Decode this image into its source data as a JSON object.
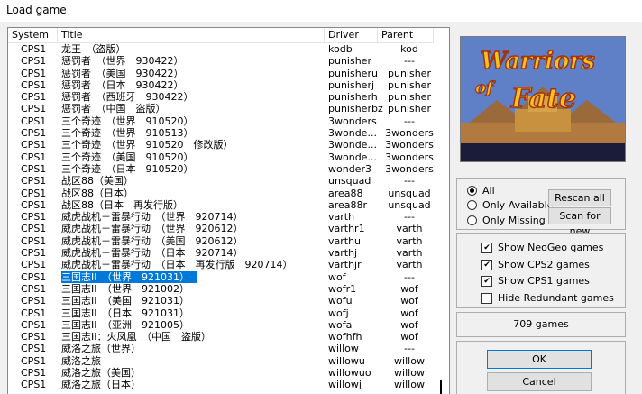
{
  "window": {
    "title": "Load game"
  },
  "columns": {
    "system": "System",
    "title": "Title",
    "driver": "Driver",
    "parent": "Parent"
  },
  "rows": [
    {
      "system": "CPS1",
      "title": "龙王　（盗版）",
      "driver": "kodb",
      "parent": "kod"
    },
    {
      "system": "CPS1",
      "title": "惩罚者　（世界　930422）",
      "driver": "punisher",
      "parent": "---"
    },
    {
      "system": "CPS1",
      "title": "惩罚者　（美国　930422）",
      "driver": "punisheru",
      "parent": "punisher"
    },
    {
      "system": "CPS1",
      "title": "惩罚者　（日本　930422）",
      "driver": "punisherj",
      "parent": "punisher"
    },
    {
      "system": "CPS1",
      "title": "惩罚者　（西班牙　930422）",
      "driver": "punisherh",
      "parent": "punisher"
    },
    {
      "system": "CPS1",
      "title": "惩罚者　（中国　盗版）",
      "driver": "punisherbz",
      "parent": "punisher"
    },
    {
      "system": "CPS1",
      "title": "三个奇迹　（世界　910520）",
      "driver": "3wonders",
      "parent": "---"
    },
    {
      "system": "CPS1",
      "title": "三个奇迹　（世界　910513）",
      "driver": "3wonde...",
      "parent": "3wonders"
    },
    {
      "system": "CPS1",
      "title": "三个奇迹　（世界　910520　修改版）",
      "driver": "3wonde...",
      "parent": "3wonders"
    },
    {
      "system": "CPS1",
      "title": "三个奇迹　（美国　910520）",
      "driver": "3wonde...",
      "parent": "3wonders"
    },
    {
      "system": "CPS1",
      "title": "三个奇迹　（日本　910520）",
      "driver": "wonder3",
      "parent": "3wonders"
    },
    {
      "system": "CPS1",
      "title": "战区88（美国）",
      "driver": "unsquad",
      "parent": "---"
    },
    {
      "system": "CPS1",
      "title": "战区88（日本）",
      "driver": "area88",
      "parent": "unsquad"
    },
    {
      "system": "CPS1",
      "title": "战区88（日本　再发行版）",
      "driver": "area88r",
      "parent": "unsquad"
    },
    {
      "system": "CPS1",
      "title": "威虎战机－雷暴行动　（世界　920714）",
      "driver": "varth",
      "parent": "---"
    },
    {
      "system": "CPS1",
      "title": "威虎战机－雷暴行动　（世界　920612）",
      "driver": "varthr1",
      "parent": "varth"
    },
    {
      "system": "CPS1",
      "title": "威虎战机－雷暴行动　（美国　920612）",
      "driver": "varthu",
      "parent": "varth"
    },
    {
      "system": "CPS1",
      "title": "威虎战机－雷暴行动　（日本　920714）",
      "driver": "varthj",
      "parent": "varth"
    },
    {
      "system": "CPS1",
      "title": "威虎战机－雷暴行动　（日本　再发行版　920714）",
      "driver": "varthjr",
      "parent": "varth"
    },
    {
      "system": "CPS1",
      "title": "三国志II　（世界　921031）",
      "driver": "wof",
      "parent": "---"
    },
    {
      "system": "CPS1",
      "title": "三国志II　（世界　921002）",
      "driver": "wofr1",
      "parent": "wof"
    },
    {
      "system": "CPS1",
      "title": "三国志II　（美国　921031）",
      "driver": "wofu",
      "parent": "wof"
    },
    {
      "system": "CPS1",
      "title": "三国志II　（日本　921031）",
      "driver": "wofj",
      "parent": "wof"
    },
    {
      "system": "CPS1",
      "title": "三国志II　（亚洲　921005）",
      "driver": "wofa",
      "parent": "wof"
    },
    {
      "system": "CPS1",
      "title": "三国志II：火凤凰　（中国　盗版）",
      "driver": "wofhfh",
      "parent": "wof"
    },
    {
      "system": "CPS1",
      "title": "威洛之旅（世界）",
      "driver": "willow",
      "parent": "---"
    },
    {
      "system": "CPS1",
      "title": "威洛之旅",
      "driver": "willowu",
      "parent": "willow"
    },
    {
      "system": "CPS1",
      "title": "威洛之旅（美国）",
      "driver": "willowuo",
      "parent": "willow"
    },
    {
      "system": "CPS1",
      "title": "威洛之旅（日本）",
      "driver": "willowj",
      "parent": "willow"
    }
  ],
  "selected_index": 19,
  "preview": {
    "logo_line1": "Warriors",
    "logo_line2": "of",
    "logo_line3": "Fate"
  },
  "radios": [
    {
      "label": "All",
      "checked": true
    },
    {
      "label": "Only Available",
      "checked": false
    },
    {
      "label": "Only Missing",
      "checked": false
    }
  ],
  "buttons": {
    "rescan_all": "Rescan all",
    "scan_new": "Scan for new",
    "ok": "OK",
    "cancel": "Cancel"
  },
  "checkboxes": [
    {
      "label": "Show NeoGeo games",
      "checked": true
    },
    {
      "label": "Show CPS2 games",
      "checked": true
    },
    {
      "label": "Show CPS1 games",
      "checked": true
    },
    {
      "label": "Hide Redundant games",
      "checked": false
    }
  ],
  "game_count": "709 games",
  "colors": {
    "selection": "#0078d7",
    "preview_sky": "#6a86c8",
    "logo": "#f6c21c"
  }
}
